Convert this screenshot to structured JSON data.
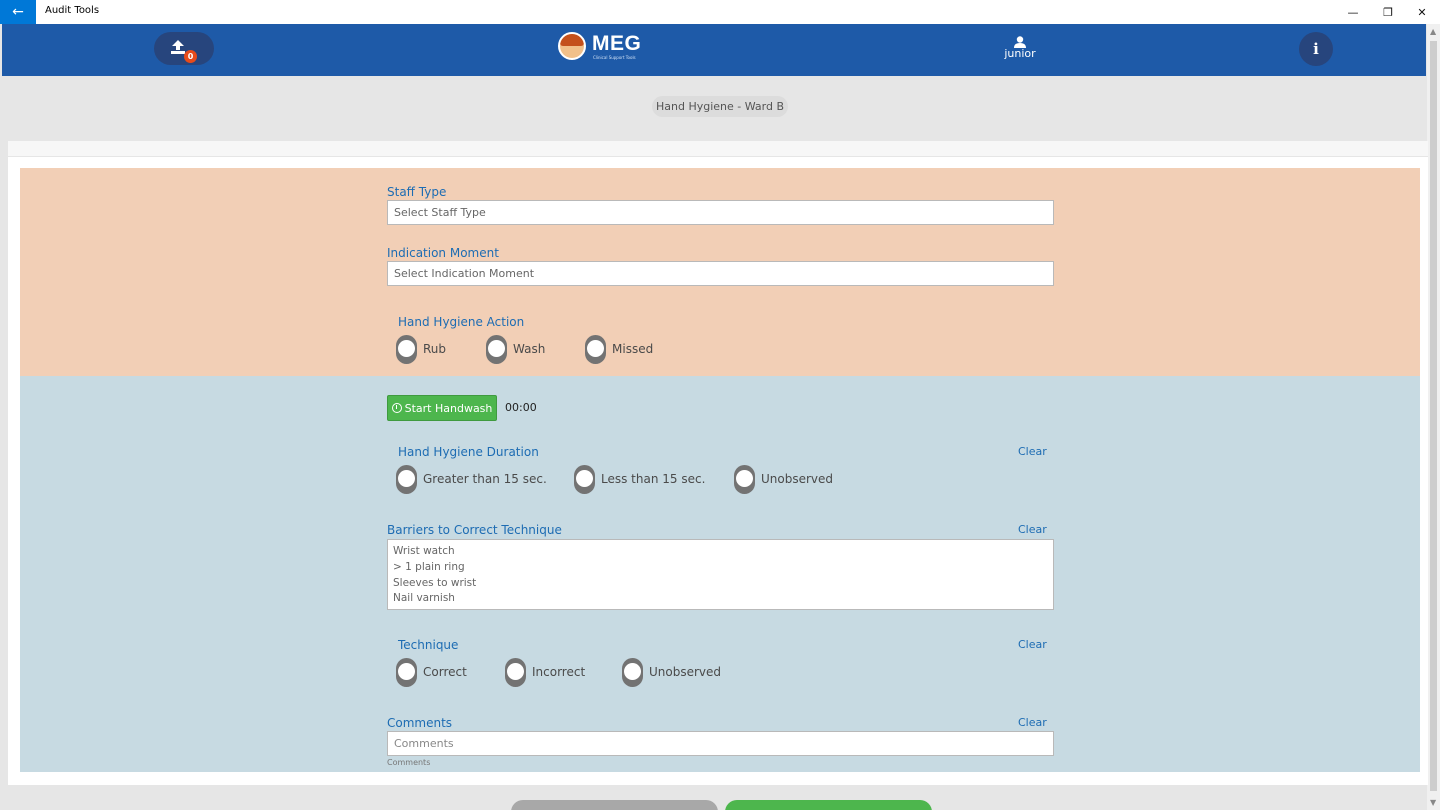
{
  "window": {
    "title": "Audit Tools",
    "back_glyph": "←",
    "minimize_glyph": "—",
    "maximize_glyph": "❐",
    "close_glyph": "✕"
  },
  "header": {
    "upload_count": "0",
    "logo_text": "MEG",
    "logo_tagline": "Clinical Support Tools",
    "username": "junior",
    "info_glyph": "i",
    "colors": {
      "bar": "#1e5aa8",
      "pill": "#27457d",
      "badge": "#e84b1a"
    }
  },
  "breadcrumb": "Hand Hygiene - Ward B",
  "form": {
    "staff_type": {
      "label": "Staff Type",
      "placeholder": "Select Staff Type"
    },
    "indication_moment": {
      "label": "Indication Moment",
      "placeholder": "Select Indication Moment"
    },
    "action": {
      "label": "Hand Hygiene Action",
      "options": [
        "Rub",
        "Wash",
        "Missed"
      ]
    },
    "start_button": "Start Handwash",
    "timer": "00:00",
    "duration": {
      "label": "Hand Hygiene Duration",
      "clear": "Clear",
      "options": [
        "Greater than 15 sec.",
        "Less than 15 sec.",
        "Unobserved"
      ]
    },
    "barriers": {
      "label": "Barriers to Correct Technique",
      "clear": "Clear",
      "items": [
        "Wrist watch",
        "> 1 plain ring",
        "Sleeves to wrist",
        "Nail varnish"
      ]
    },
    "technique": {
      "label": "Technique",
      "clear": "Clear",
      "options": [
        "Correct",
        "Incorrect",
        "Unobserved"
      ]
    },
    "comments": {
      "label": "Comments",
      "clear": "Clear",
      "placeholder": "Comments",
      "hint": "Comments"
    },
    "colors": {
      "section_top": "#f2cfb6",
      "section_bottom": "#c7dae2",
      "label": "#1d6cb3",
      "start_button": "#4db64d"
    }
  }
}
